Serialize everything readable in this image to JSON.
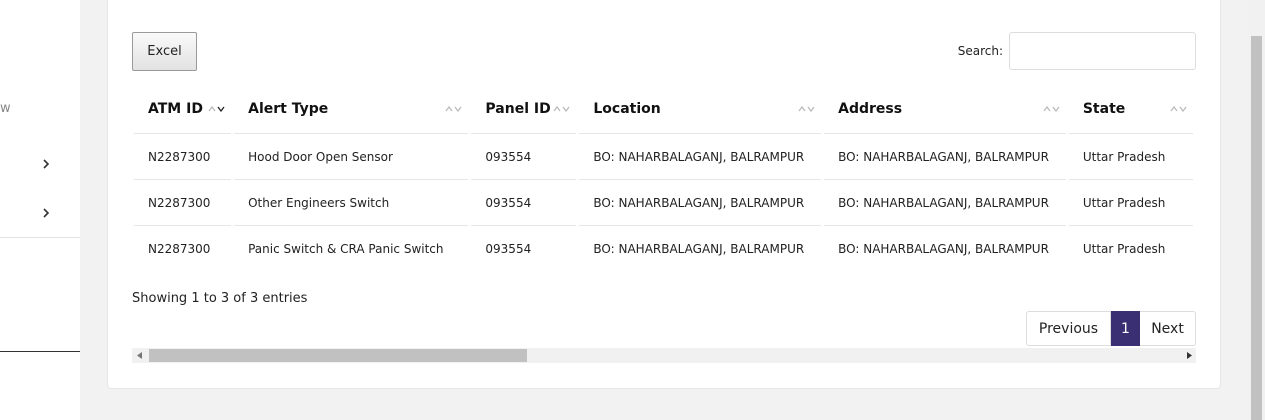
{
  "sidebar": {
    "fragment_text": "w"
  },
  "toolbar": {
    "excel_label": "Excel",
    "search_label": "Search:",
    "search_value": ""
  },
  "table": {
    "columns": [
      "ATM ID",
      "Alert Type",
      "Panel ID",
      "Location",
      "Address",
      "State"
    ],
    "rows": [
      [
        "N2287300",
        "Hood Door Open Sensor",
        "093554",
        "BO: NAHARBALAGANJ, BALRAMPUR",
        "BO: NAHARBALAGANJ, BALRAMPUR",
        "Uttar Pradesh"
      ],
      [
        "N2287300",
        "Other Engineers Switch",
        "093554",
        "BO: NAHARBALAGANJ, BALRAMPUR",
        "BO: NAHARBALAGANJ, BALRAMPUR",
        "Uttar Pradesh"
      ],
      [
        "N2287300",
        "Panic Switch & CRA Panic Switch",
        "093554",
        "BO: NAHARBALAGANJ, BALRAMPUR",
        "BO: NAHARBALAGANJ, BALRAMPUR",
        "Uttar Pradesh"
      ]
    ]
  },
  "info": {
    "text": "Showing 1 to 3 of 3 entries"
  },
  "pagination": {
    "previous_label": "Previous",
    "current_page": "1",
    "next_label": "Next"
  },
  "colors": {
    "accent": "#3b2f74",
    "page_bg": "#f2f2f2"
  }
}
